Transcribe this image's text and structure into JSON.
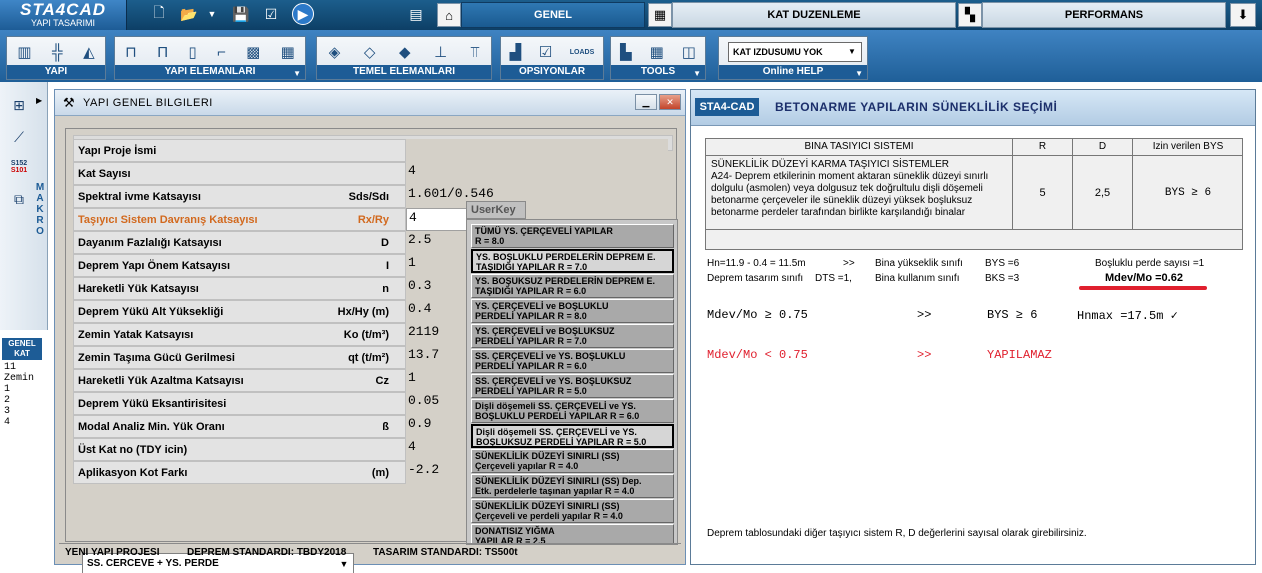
{
  "app": {
    "logo_title": "STA4CAD",
    "logo_subtitle": "YAPI TASARIMI"
  },
  "tabs": [
    {
      "label": "GENEL",
      "active": true
    },
    {
      "label": "KAT DUZENLEME",
      "active": false
    },
    {
      "label": "PERFORMANS",
      "active": false
    }
  ],
  "toolbar": {
    "groups": [
      {
        "label": "YAPI"
      },
      {
        "label": "YAPI ELEMANLARI"
      },
      {
        "label": "TEMEL ELEMANLARI"
      },
      {
        "label": "OPSIYONLAR"
      },
      {
        "label": "TOOLS"
      },
      {
        "label": "Online HELP"
      }
    ],
    "kat_select": "KAT IZDUSUMU YOK",
    "loads_label": "LOADS"
  },
  "sidebar": {
    "makro_label": "MAKRO",
    "s152": "S152",
    "s101": "S101",
    "genel_kat_label": "GENEL KAT",
    "floors": [
      "11",
      "Zemin",
      "1",
      "2",
      "3",
      "4"
    ]
  },
  "dialog1": {
    "title": "YAPI GENEL BILGILERI",
    "rows": [
      {
        "name": "Yapı Proje İsmi",
        "symbol": "",
        "value": ""
      },
      {
        "name": "Kat Sayısı",
        "symbol": "",
        "value": "4"
      },
      {
        "name": "Spektral ivme Katsayısı",
        "symbol": "Sds/Sdı",
        "value": "1.601/0.546"
      },
      {
        "name": "Taşıyıcı Sistem Davranış Katsayısı",
        "symbol": "Rx/Ry",
        "value": "4"
      },
      {
        "name": "Dayanım Fazlalığı Katsayısı",
        "symbol": "D",
        "value": "2.5"
      },
      {
        "name": "Deprem Yapı Önem Katsayısı",
        "symbol": "I",
        "value": "1"
      },
      {
        "name": "Hareketli Yük Katsayısı",
        "symbol": "n",
        "value": "0.3"
      },
      {
        "name": "Deprem Yükü Alt Yüksekliği",
        "symbol": "Hx/Hy  (m)",
        "value": "0.4"
      },
      {
        "name": "Zemin Yatak Katsayısı",
        "symbol": "Ko  (t/m³)",
        "value": "2119"
      },
      {
        "name": "Zemin Taşıma Gücü Gerilmesi",
        "symbol": "qt  (t/m²)",
        "value": "13.7"
      },
      {
        "name": "Hareketli Yük Azaltma Katsayısı",
        "symbol": "Cz",
        "value": "1"
      },
      {
        "name": "Deprem Yükü Eksantirisitesi",
        "symbol": "",
        "value": "0.05"
      },
      {
        "name": "Modal Analiz Min. Yük Oranı",
        "symbol": "ß",
        "value": "0.9"
      },
      {
        "name": "Üst Kat no (TDY icin)",
        "symbol": "",
        "value": "4"
      },
      {
        "name": "Aplikasyon Kot Farkı",
        "symbol": "(m)",
        "value": "-2.2"
      }
    ],
    "userkey_label": "UserKey",
    "options": [
      {
        "l1": "TÜMÜ YS. ÇERÇEVELİ YAPILAR",
        "l2": "R = 8.0"
      },
      {
        "l1": "YS. BOŞLUKLU PERDELERİN DEPREM E.",
        "l2": "TAŞIDIĞI YAPILAR      R = 7.0"
      },
      {
        "l1": "YS. BOŞUKSUZ PERDELERİN DEPREM E.",
        "l2": "TAŞIDIĞI YAPILAR      R = 6.0"
      },
      {
        "l1": "YS. ÇERÇEVELİ ve BOŞLUKLU",
        "l2": "PERDELİ YAPILAR      R = 8.0"
      },
      {
        "l1": "YS. ÇERÇEVELİ ve BOŞLUKSUZ",
        "l2": "PERDELİ YAPILAR      R = 7.0"
      },
      {
        "l1": "SS. ÇERÇEVELİ ve YS. BOŞLUKLU",
        "l2": "PERDELİ YAPILAR      R = 6.0"
      },
      {
        "l1": "SS. ÇERÇEVELİ ve YS. BOŞLUKSUZ",
        "l2": "PERDELİ YAPILAR      R = 5.0"
      },
      {
        "l1": "Dişli döşemeli SS. ÇERÇEVELİ ve YS.",
        "l2": "BOŞLUKLU PERDELİ YAPILAR  R = 6.0"
      },
      {
        "l1": "Dişli döşemeli SS. ÇERÇEVELİ ve YS.",
        "l2": "BOŞLUKSUZ PERDELİ YAPILAR R = 5.0"
      },
      {
        "l1": "SÜNEKLİLİK DÜZEYİ SINIRLI (SS)",
        "l2": "Çerçeveli yapılar R = 4.0"
      },
      {
        "l1": "SÜNEKLİLİK DÜZEYİ SINIRLI (SS) Dep.",
        "l2": "Etk. perdelerle taşınan yapılar R = 4.0"
      },
      {
        "l1": "SÜNEKLİLİK DÜZEYİ SINIRLI (SS)",
        "l2": "Çerçeveli ve perdeli yapılar R = 4.0"
      },
      {
        "l1": "DONATISIZ YIĞMA",
        "l2": "YAPILAR   R = 2.5"
      }
    ],
    "combo_value": "SS. CERCEVE + YS. PERDE",
    "status": {
      "project": "YENI YAPI PROJESI",
      "deprem": "DEPREM STANDARDI: TBDY2018",
      "tasarim": "TASARIM STANDARDI: TS500t"
    }
  },
  "dialog2": {
    "tag": "STA4-CAD",
    "title": "BETONARME YAPILARIN SÜNEKLİLİK SEÇİMİ",
    "table": {
      "headers": [
        "BINA TASIYICI SISTEMI",
        "R",
        "D",
        "Izin verilen BYS"
      ],
      "row_title": "SÜNEKLİLİK DÜZEYİ KARMA TAŞIYICI SİSTEMLER",
      "row_desc": [
        "A24- Deprem etkilerinin moment aktaran süneklik düzeyi sınırlı",
        "dolgulu (asmolen) veya dolgusuz tek doğrultulu dişli döşemeli",
        "betonarme çerçeveler ile süneklik düzeyi yüksek boşluksuz",
        "betonarme perdeler tarafından birlikte karşılandığı binalar"
      ],
      "R": "5",
      "D": "2,5",
      "bys": "BYS  ≥  6"
    },
    "info": {
      "hn": "Hn=11.9 - 0.4 = 11.5m",
      "arrow1": ">>",
      "bina_yuk": "Bina yükseklik sınıfı",
      "bys6": "BYS =6",
      "bosluklu": "Boşluklu perde sayısı =1",
      "deprem_sinif": "Deprem tasarım sınıfı",
      "dts": "DTS =1,",
      "bina_kul": "Bina kullanım  sınıfı",
      "bks": "BKS =3",
      "mdev": "Mdev/Mo =0.62"
    },
    "cond1": {
      "left": "Mdev/Mo ≥ 0.75",
      "arrow": ">>",
      "bys": "BYS  ≥ 6",
      "hnmax": "Hnmax =17.5m ✓"
    },
    "cond2": {
      "left": "Mdev/Mo < 0.75",
      "arrow": ">>",
      "result": "YAPILAMAZ"
    },
    "footer": "Deprem tablosundaki diğer taşıyıcı sistem R, D değerlerini sayısal olarak girebilirsiniz.",
    "accent_red": "#e0202e"
  }
}
